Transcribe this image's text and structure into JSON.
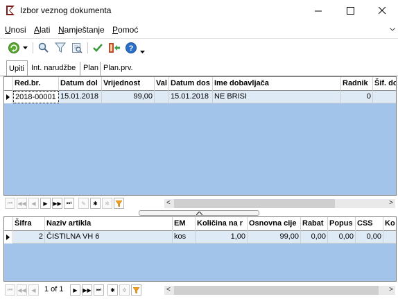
{
  "window": {
    "title": "Izbor veznog dokumenta",
    "minimize": "—",
    "maximize": "☐",
    "close": "✕"
  },
  "menu": {
    "items": [
      "Unosi",
      "Alati",
      "Namještanje",
      "Pomoć"
    ],
    "underline": [
      "U",
      "A",
      "N",
      "P"
    ],
    "rest": [
      "nosi",
      "lati",
      "amještanje",
      "omoć"
    ]
  },
  "toolbar": {
    "icons": [
      "refresh-icon",
      "dropdown-arrow-icon",
      "search-icon",
      "filter-icon",
      "find-document-icon",
      "check-icon",
      "transfer-icon",
      "help-icon",
      "more-icon"
    ]
  },
  "tabs": [
    "Upiti",
    "Int. narudžbe",
    "Plan",
    "Plan.prv."
  ],
  "upper_grid": {
    "columns": [
      "Red.br.",
      "Datum dol",
      "Vrijednost",
      "Val",
      "Datum dos",
      "Ime dobavljača",
      "Radnik",
      "Šif. do"
    ],
    "rows": [
      [
        "2018-00001",
        "15.01.2018",
        "99,00",
        "",
        "15.01.2018",
        "NE BRISI",
        "0",
        ""
      ]
    ]
  },
  "lower_grid": {
    "columns": [
      "Šifra",
      "Naziv artikla",
      "EM",
      "Količina na r",
      "Osnovna cije",
      "Rabat",
      "Popus",
      "CSS",
      "Ko"
    ],
    "rows": [
      [
        "2",
        "ČISTILNA VH 6",
        "kos",
        "1,00",
        "99,00",
        "0,00",
        "0,00",
        "0,00",
        ""
      ]
    ]
  },
  "pager": {
    "label": "1 of 1"
  },
  "colors": {
    "grid_bg": "#a3c4ea",
    "row_bg": "#dfeaf7",
    "refresh_green": "#5aa832",
    "help_blue": "#2a6fc9",
    "filter_orange": "#f0a020"
  }
}
